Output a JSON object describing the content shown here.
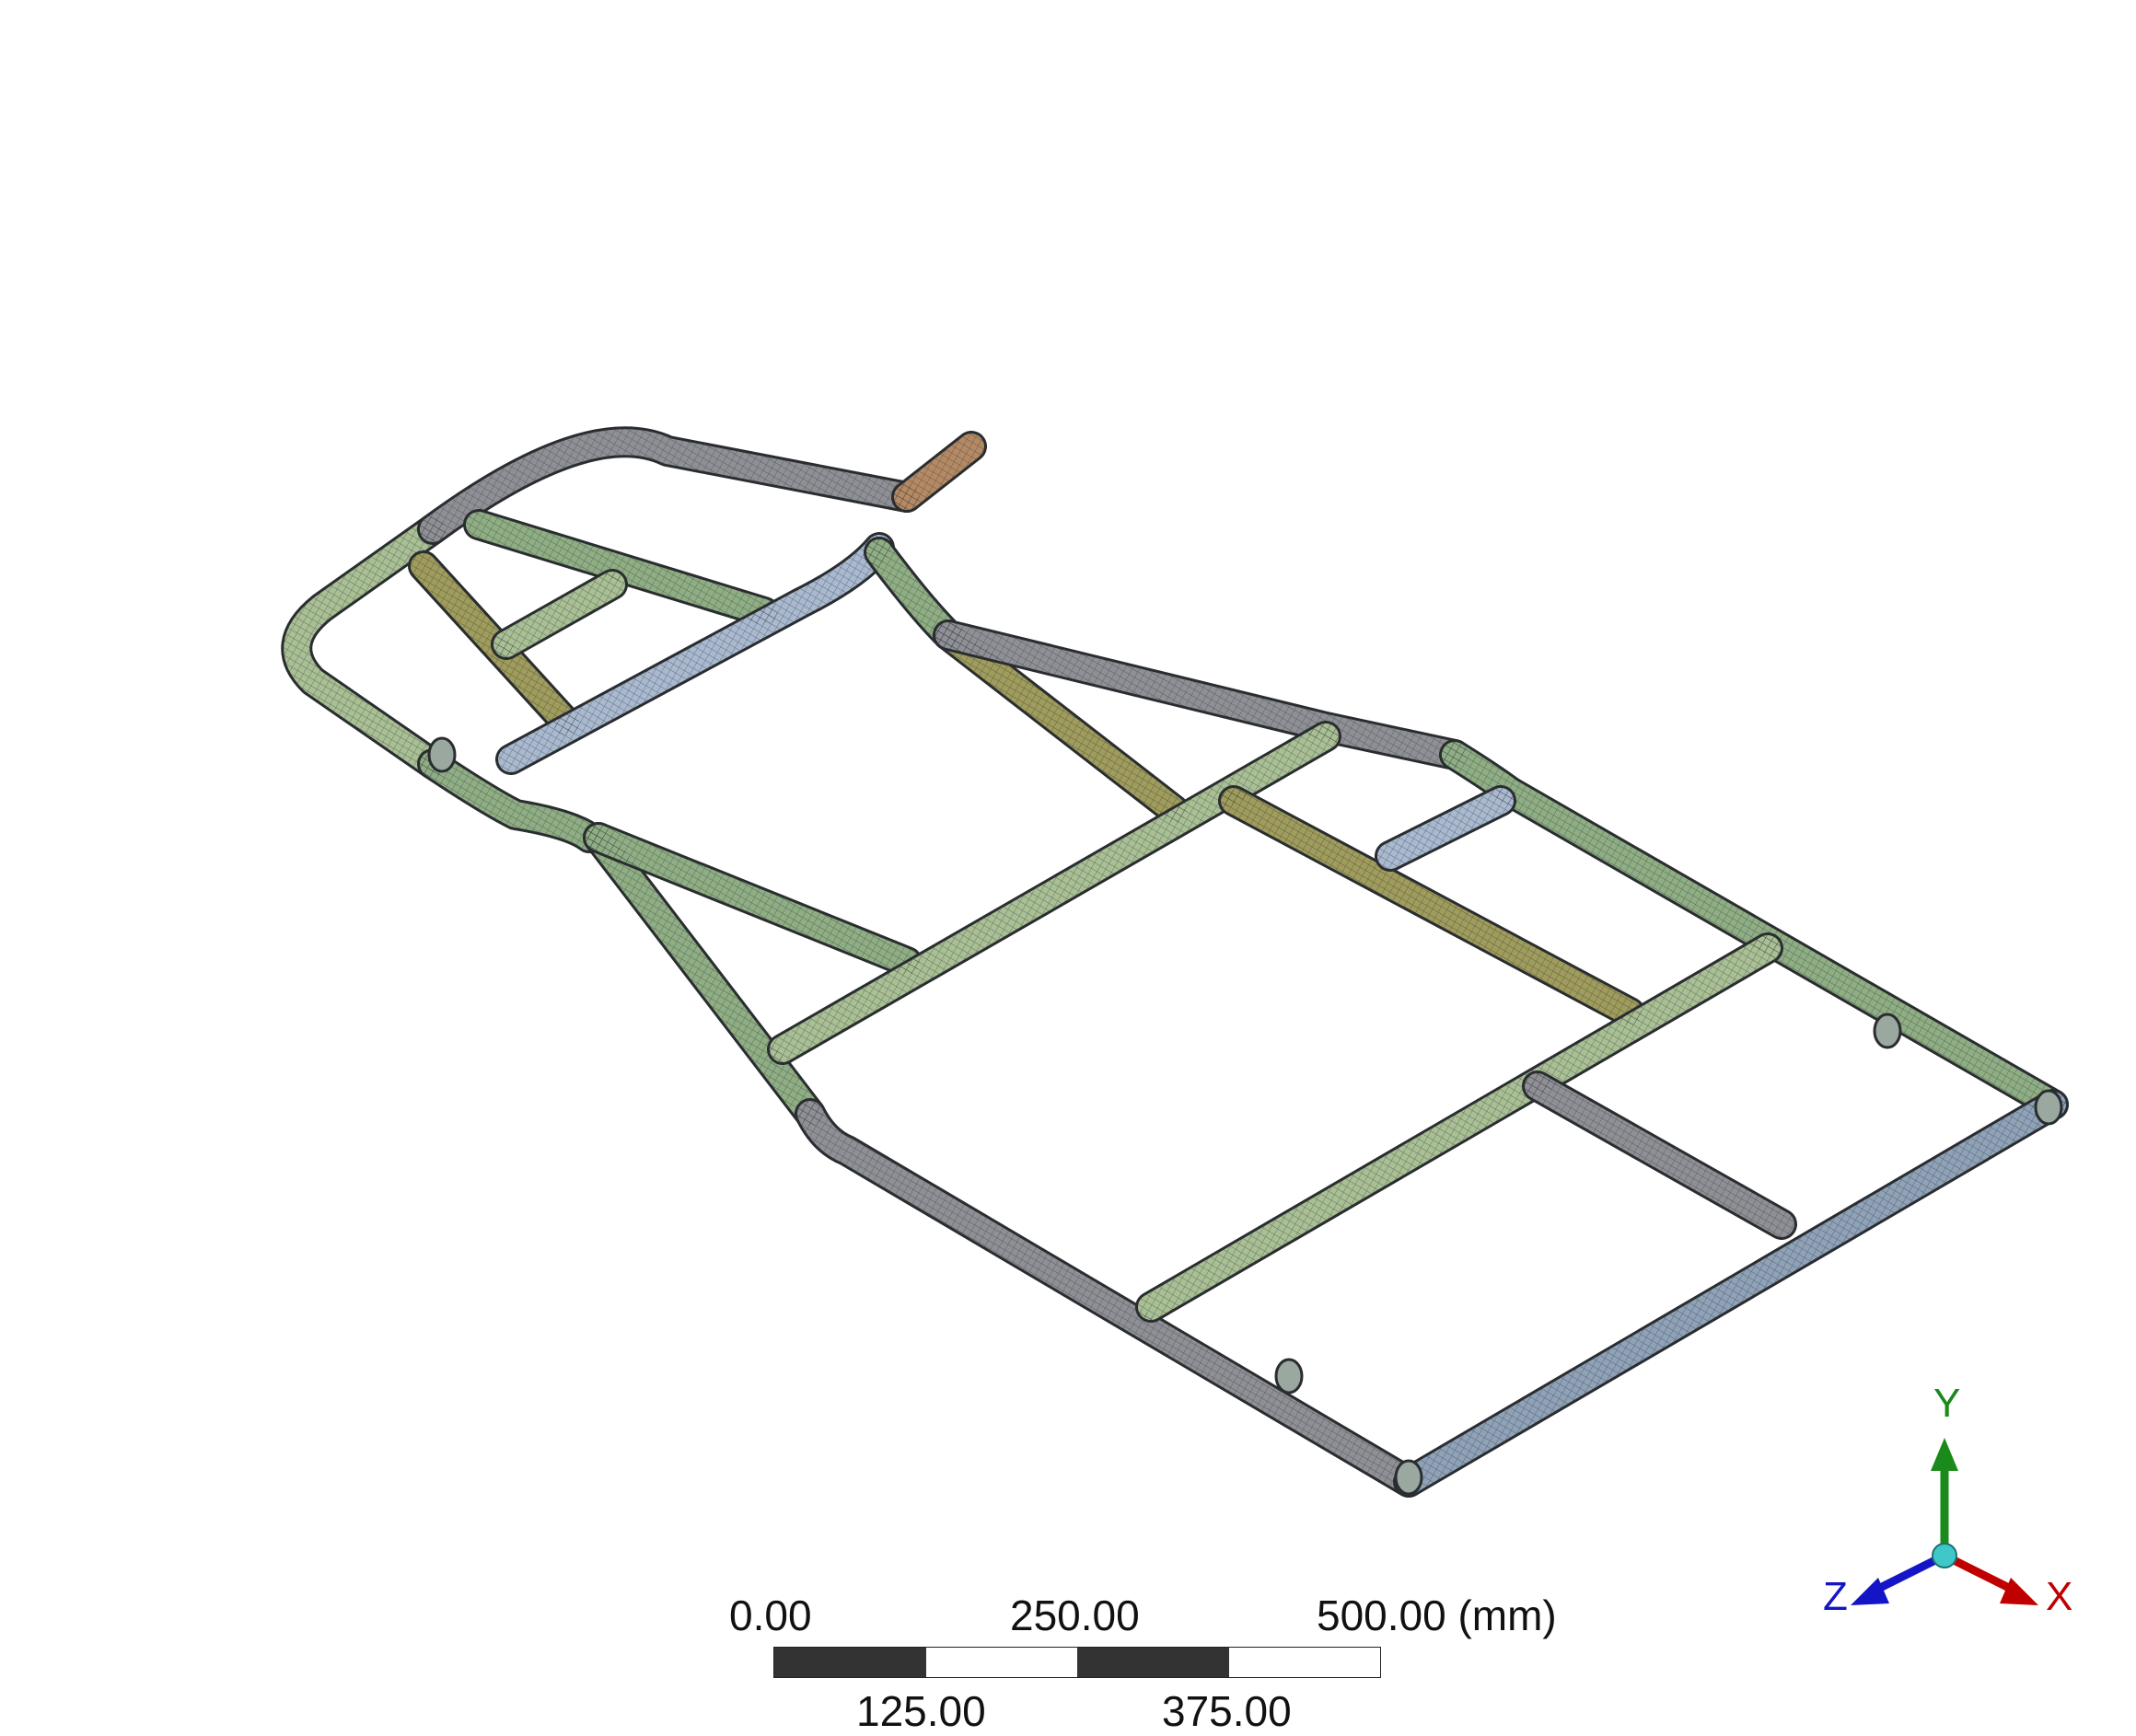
{
  "viewport": {
    "model": "tube-frame-chassis-mesh",
    "background_color": "#ffffff",
    "tube_colors": {
      "gray": "#8e9096",
      "blue_gray": "#8fa2b8",
      "green": "#8fae84",
      "olive": "#9f9c5c",
      "sage": "#a9bf94",
      "light_blue": "#a9b9cf",
      "copper": "#b48a64"
    }
  },
  "scale_bar": {
    "top_labels": [
      "0.00",
      "250.00",
      "500.00 (mm)"
    ],
    "bottom_labels": [
      "125.00",
      "375.00"
    ],
    "segment_colors": [
      "#333333",
      "#ffffff",
      "#333333",
      "#ffffff"
    ]
  },
  "triad": {
    "y_label": "Y",
    "x_label": "X",
    "z_label": "Z",
    "y_color": "#1a8a1a",
    "x_color": "#c00000",
    "z_color": "#1515c8",
    "origin_color": "#40c8c8"
  }
}
